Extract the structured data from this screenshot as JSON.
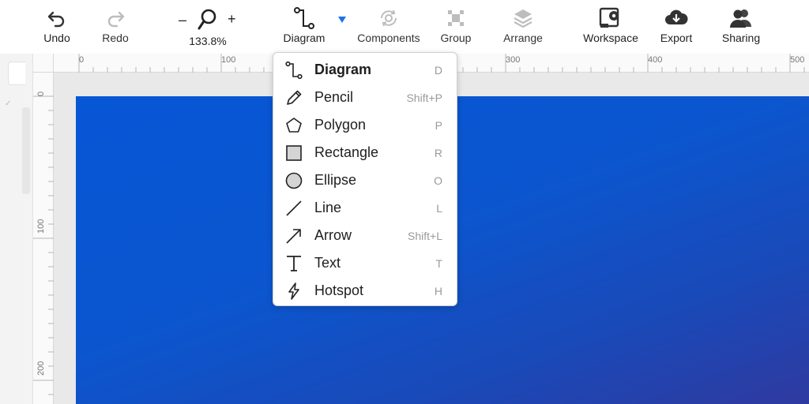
{
  "toolbar": {
    "undo": {
      "label": "Undo",
      "icon": "undo-icon"
    },
    "redo": {
      "label": "Redo",
      "icon": "redo-icon"
    },
    "zoom": {
      "minus": "–",
      "plus": "+",
      "value": "133.8%",
      "icon": "magnifier-icon"
    },
    "diagram": {
      "label": "Diagram",
      "icon": "diagram-connector-icon"
    },
    "components": {
      "label": "Components",
      "icon": "components-icon"
    },
    "group": {
      "label": "Group",
      "icon": "group-icon"
    },
    "arrange": {
      "label": "Arrange",
      "icon": "layers-icon"
    },
    "workspace": {
      "label": "Workspace",
      "icon": "workspace-gear-icon"
    },
    "export": {
      "label": "Export",
      "icon": "cloud-download-icon"
    },
    "sharing": {
      "label": "Sharing",
      "icon": "users-icon"
    }
  },
  "ruler": {
    "top_labels": [
      "0",
      "100",
      "300",
      "400",
      "500"
    ],
    "left_labels": [
      "0",
      "100",
      "200"
    ]
  },
  "menu": {
    "items": [
      {
        "label": "Diagram",
        "shortcut": "D",
        "icon": "diagram-connector-icon",
        "active": true
      },
      {
        "label": "Pencil",
        "shortcut": "Shift+P",
        "icon": "pencil-icon"
      },
      {
        "label": "Polygon",
        "shortcut": "P",
        "icon": "pentagon-icon"
      },
      {
        "label": "Rectangle",
        "shortcut": "R",
        "icon": "rectangle-icon"
      },
      {
        "label": "Ellipse",
        "shortcut": "O",
        "icon": "ellipse-icon"
      },
      {
        "label": "Line",
        "shortcut": "L",
        "icon": "line-icon"
      },
      {
        "label": "Arrow",
        "shortcut": "Shift+L",
        "icon": "arrow-icon"
      },
      {
        "label": "Text",
        "shortcut": "T",
        "icon": "text-icon"
      },
      {
        "label": "Hotspot",
        "shortcut": "H",
        "icon": "lightning-icon"
      }
    ]
  },
  "colors": {
    "accent": "#1a73e8",
    "canvas_blue": "#0756d6",
    "menu_bg": "#ffffff"
  }
}
